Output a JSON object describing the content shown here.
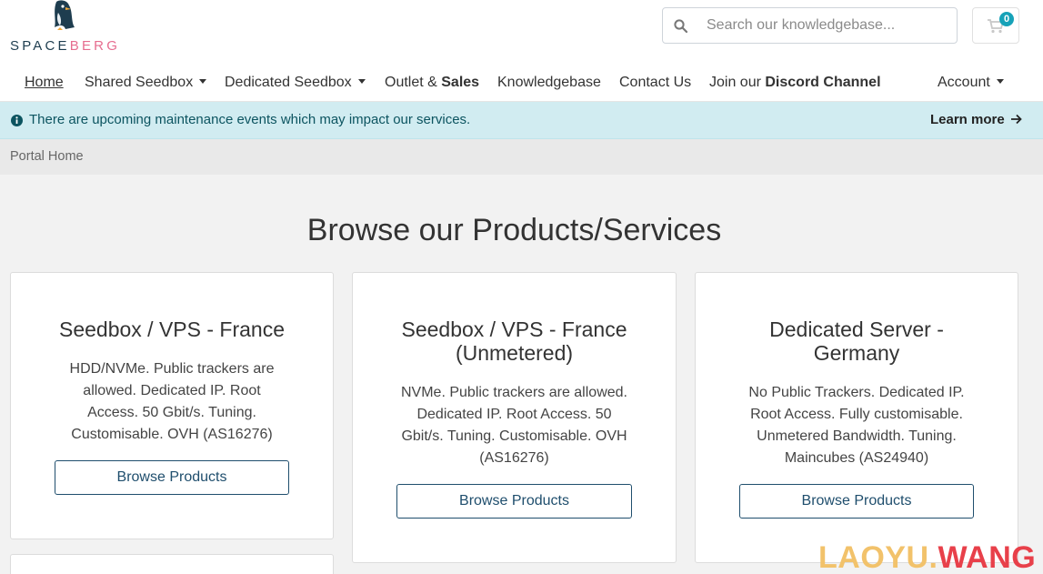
{
  "brand": {
    "name_part1": "SPACE",
    "name_part2": "BERG"
  },
  "search": {
    "placeholder": "Search our knowledgebase..."
  },
  "cart": {
    "count": "0"
  },
  "nav": {
    "home": "Home",
    "shared_seedbox": "Shared Seedbox",
    "dedicated_seedbox": "Dedicated Seedbox",
    "outlet_prefix": "Outlet & ",
    "outlet_bold": "Sales",
    "knowledgebase": "Knowledgebase",
    "contact_us": "Contact Us",
    "discord_prefix": "Join our ",
    "discord_bold": "Discord Channel",
    "account": "Account"
  },
  "alert": {
    "message": "There are upcoming maintenance events which may impact our services.",
    "learn_more": "Learn more"
  },
  "breadcrumb": {
    "current": "Portal Home"
  },
  "main": {
    "title": "Browse our Products/Services",
    "cards": [
      {
        "title_line1": "Seedbox / VPS - France",
        "title_line2": "",
        "desc_lines": [
          "HDD/NVMe. Public trackers are",
          "allowed. Dedicated IP. Root",
          "Access. 50 Gbit/s. Tuning.",
          "Customisable. OVH (AS16276)"
        ],
        "button": "Browse Products"
      },
      {
        "title_line1": "Seedbox / VPS - France",
        "title_line2": "(Unmetered)",
        "desc_lines": [
          "NVMe. Public trackers are allowed.",
          "Dedicated IP. Root Access. 50",
          "Gbit/s. Tuning. Customisable. OVH",
          "(AS16276)"
        ],
        "button": "Browse Products"
      },
      {
        "title_line1": "Dedicated Server -",
        "title_line2": "Germany",
        "desc_lines": [
          "No Public Trackers. Dedicated IP.",
          "Root Access. Fully customisable.",
          "Unmetered Bandwidth. Tuning.",
          "Maincubes (AS24940)"
        ],
        "button": "Browse Products"
      }
    ]
  },
  "watermark": {
    "part1": "LAOYU.",
    "part2": "WANG"
  },
  "colors": {
    "accent": "#1f4e6d",
    "badge": "#17a2b8",
    "alert_bg": "#d1ecf1",
    "brand_pink": "#e66d8f"
  }
}
